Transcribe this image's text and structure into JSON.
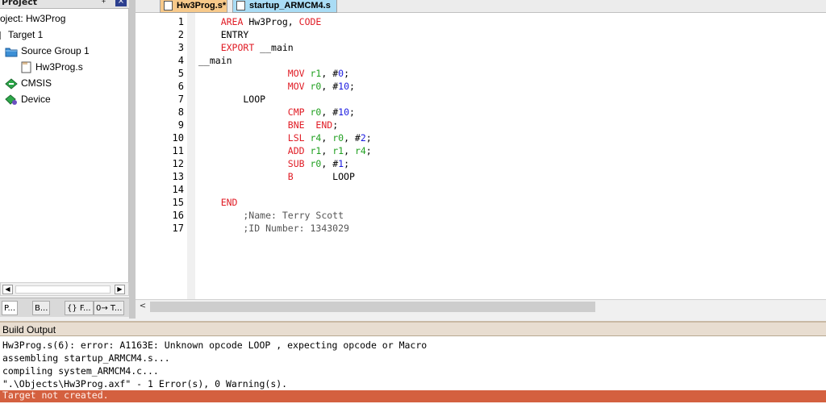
{
  "project": {
    "header_title": "Project",
    "pin_glyph": "‡",
    "close_glyph": "×",
    "tree": [
      {
        "label": "oject: Hw3Prog",
        "icon": "none"
      },
      {
        "label": "Target 1",
        "icon": "none"
      },
      {
        "label": "Source Group 1",
        "icon": "folder-icon"
      },
      {
        "label": "Hw3Prog.s",
        "icon": "file-icon"
      },
      {
        "label": "CMSIS",
        "icon": "component-icon"
      },
      {
        "label": "Device",
        "icon": "device-icon"
      }
    ],
    "tabs": [
      {
        "label": "P..."
      },
      {
        "label": "B..."
      },
      {
        "label": "{} F..."
      },
      {
        "label": "0→ T..."
      }
    ]
  },
  "editor": {
    "tabs": [
      {
        "label": "Hw3Prog.s*"
      },
      {
        "label": "startup_ARMCM4.s"
      }
    ],
    "line_numbers": [
      "1",
      "2",
      "3",
      "4",
      "5",
      "6",
      "7",
      "8",
      "9",
      "10",
      "11",
      "12",
      "13",
      "14",
      "15",
      "16",
      "17"
    ],
    "code_lines": [
      "    AREA Hw3Prog, CODE",
      "    ENTRY",
      "    EXPORT __main",
      "__main",
      "                MOV r1, #0;",
      "                MOV r0, #10;",
      "        LOOP",
      "                CMP r0, #10;",
      "                BNE  END;",
      "                LSL r4, r0, #2;",
      "                ADD r1, r1, r4;",
      "                SUB r0, #1;",
      "                B       LOOP",
      "",
      "    END",
      "        ;Name: Terry Scott",
      "        ;ID Number: 1343029"
    ]
  },
  "build_output": {
    "title": "Build Output",
    "lines": [
      "Hw3Prog.s(6): error: A1163E: Unknown opcode LOOP , expecting opcode or Macro",
      "assembling startup_ARMCM4.s...",
      "compiling system_ARMCM4.c...",
      "\".\\Objects\\Hw3Prog.axf\" - 1 Error(s), 0 Warning(s)."
    ],
    "error_line": "Target not created."
  },
  "colors": {
    "keyword": "#e01b24",
    "register": "#1f9f1f",
    "number": "#1a1ae0",
    "active_tab": "#f7c98a",
    "inactive_tab": "#a9dcf5",
    "error_bar": "#d4603f"
  }
}
